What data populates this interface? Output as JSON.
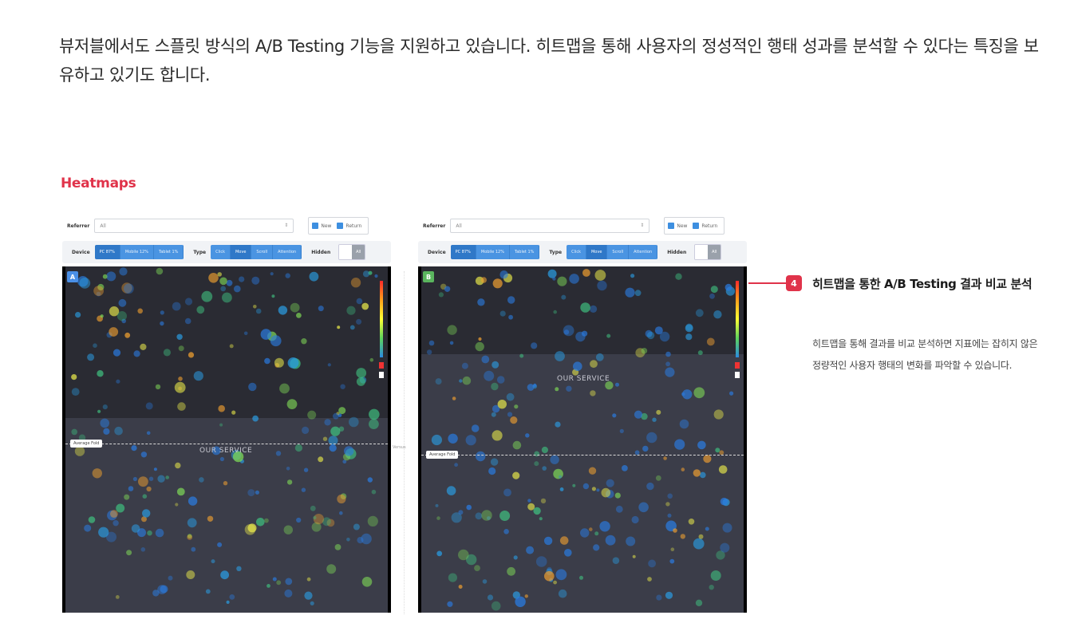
{
  "intro_text": "뷰저블에서도 스플릿 방식의 A/B Testing 기능을 지원하고 있습니다. 히트맵을 통해 사용자의 정성적인 행태 성과를 분석할 수 있다는 특징을 보유하고 있기도 합니다.",
  "figure_title": "Heatmaps",
  "panels": [
    {
      "badge": "A",
      "referrer_label": "Referrer",
      "referrer_value": "All",
      "new_label": "New",
      "return_label": "Return",
      "device_label": "Device",
      "device_options": [
        "PC 87%",
        "Mobile 12%",
        "Tablet 1%"
      ],
      "type_label": "Type",
      "type_options": [
        "Click",
        "Move",
        "Scroll",
        "Attention"
      ],
      "hidden_label": "Hidden",
      "toggle_options": [
        "",
        "All"
      ],
      "service_text": "OUR SERVICE",
      "fold_label": "Average Fold"
    },
    {
      "badge": "B",
      "referrer_label": "Referrer",
      "referrer_value": "All",
      "new_label": "New",
      "return_label": "Return",
      "device_label": "Device",
      "device_options": [
        "PC 87%",
        "Mobile 12%",
        "Tablet 1%"
      ],
      "type_label": "Type",
      "type_options": [
        "Click",
        "Move",
        "Scroll",
        "Attention"
      ],
      "hidden_label": "Hidden",
      "toggle_options": [
        "",
        "All"
      ],
      "service_text": "OUR SERVICE",
      "fold_label": "Average Fold"
    }
  ],
  "versus_label": "Versus",
  "callout": {
    "number": "4",
    "title": "히트맵을 통한 A/B Testing 결과 비교 분석",
    "body": "히트맵을 통해 결과를 비교 분석하면 지표에는 잡히지 않은 정량적인 사용자 행태의 변화를 파악할 수 있습니다."
  },
  "colors": {
    "accent": "#e0334a",
    "segment_blue": "#4a94e2",
    "badge_a": "#4a8fe6",
    "badge_b": "#5ab55e"
  }
}
